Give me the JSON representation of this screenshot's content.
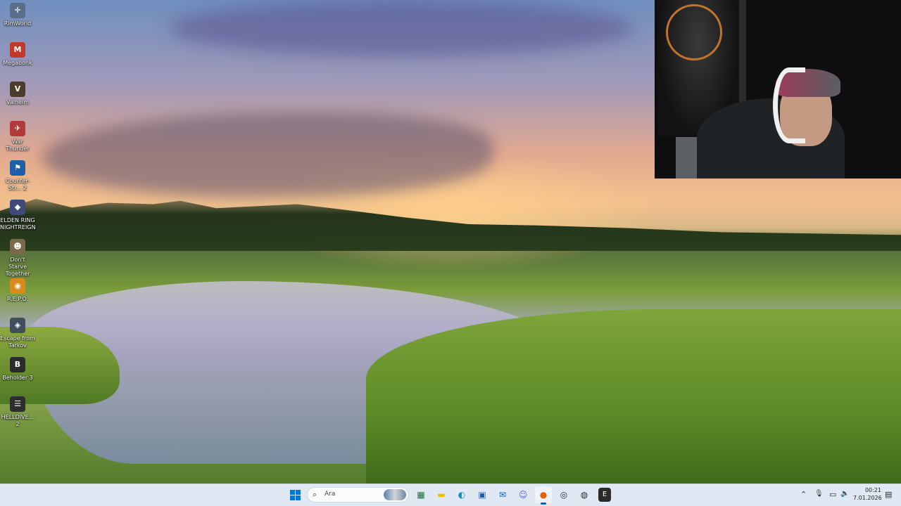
{
  "desktop": {
    "icons": [
      {
        "label": "RimWorld",
        "glyph": "✛",
        "color": "#5a6e8c"
      },
      {
        "label": "Megabonk",
        "glyph": "M",
        "color": "#c0392b"
      },
      {
        "label": "Valheim",
        "glyph": "V",
        "color": "#4a3b2a"
      },
      {
        "label": "War Thunder",
        "glyph": "✈",
        "color": "#b33a3a"
      },
      {
        "label": "Counter-Str... 2",
        "glyph": "⚑",
        "color": "#1f5fa8"
      },
      {
        "label": "ELDEN RING NIGHTREIGN",
        "glyph": "◆",
        "color": "#3d4a7a"
      },
      {
        "label": "Don't Starve Together",
        "glyph": "☻",
        "color": "#7a6a4a"
      },
      {
        "label": "R.E.P.O.",
        "glyph": "◉",
        "color": "#d98a1b"
      },
      {
        "label": "Escape from Tarkov",
        "glyph": "◈",
        "color": "#3e4e5a"
      },
      {
        "label": "Beholder 3",
        "glyph": "B",
        "color": "#2b2b2b"
      },
      {
        "label": "HELLDIVE... 2",
        "glyph": "☰",
        "color": "#2d2d2d"
      }
    ]
  },
  "taskbar": {
    "search_placeholder": "Ara",
    "search_icon": "⌕",
    "pinned": [
      {
        "name": "taskbar-app-1",
        "glyph": "▦",
        "color": "#1e6b3a",
        "active": false
      },
      {
        "name": "taskbar-file-explorer",
        "glyph": "▬",
        "color": "#f2b705",
        "active": false
      },
      {
        "name": "taskbar-edge",
        "glyph": "◐",
        "color": "#0f8fb8",
        "active": false
      },
      {
        "name": "taskbar-store",
        "glyph": "▣",
        "color": "#1c5fa8",
        "active": false
      },
      {
        "name": "taskbar-outlook",
        "glyph": "✉",
        "color": "#0a64ad",
        "active": false
      },
      {
        "name": "taskbar-discord",
        "glyph": "☺",
        "color": "#5865f2",
        "active": false
      },
      {
        "name": "taskbar-firefox",
        "glyph": "●",
        "color": "#e66000",
        "active": true
      },
      {
        "name": "taskbar-steam",
        "glyph": "◎",
        "color": "#1b2838",
        "active": false
      },
      {
        "name": "taskbar-obs",
        "glyph": "◍",
        "color": "#2c2c2c",
        "active": false
      },
      {
        "name": "taskbar-epic-games",
        "glyph": "E",
        "color": "#2a2a2a",
        "active": false
      }
    ],
    "tray": {
      "chevron": "⌃",
      "mic": "🎙",
      "network": "▭",
      "volume": "🔈",
      "notification": "▤"
    },
    "clock": {
      "time": "00:21",
      "date": "7.01.2026"
    }
  }
}
